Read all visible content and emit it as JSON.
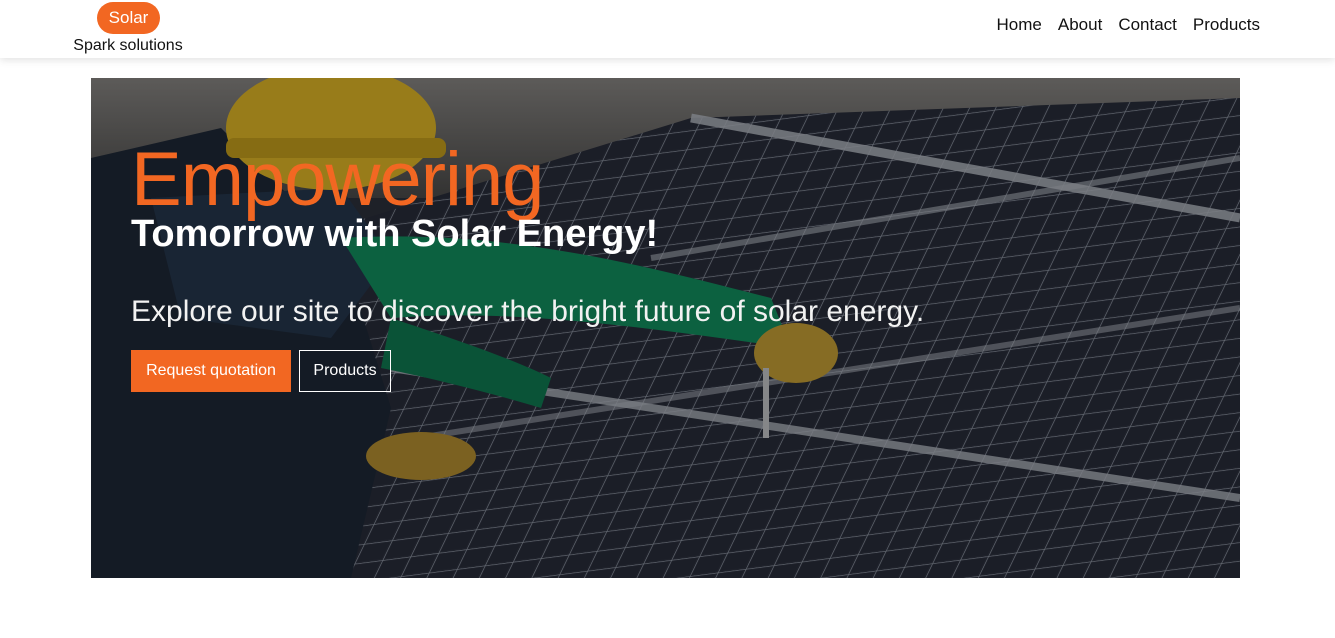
{
  "brand": {
    "badge": "Solar",
    "tagline": "Spark solutions",
    "accent_color": "#f26722"
  },
  "nav": {
    "items": [
      {
        "label": "Home"
      },
      {
        "label": "About"
      },
      {
        "label": "Contact"
      },
      {
        "label": "Products"
      }
    ]
  },
  "hero": {
    "title": "Empowering",
    "subtitle": "Tomorrow with Solar Energy!",
    "description": "Explore our site to discover the bright future of solar energy.",
    "primary_button": "Request quotation",
    "secondary_button": "Products",
    "background": "photo-of-technician-installing-solar-panels"
  }
}
